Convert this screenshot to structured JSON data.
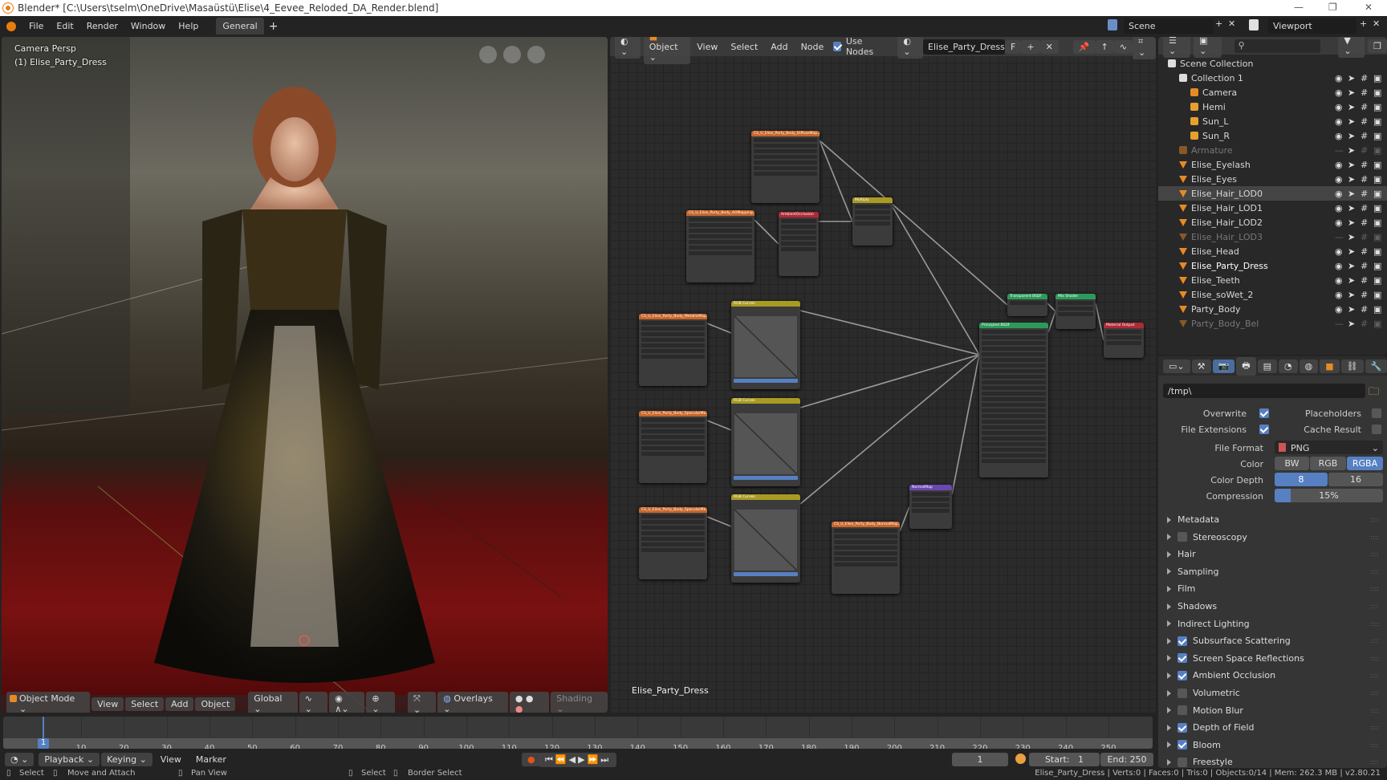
{
  "window": {
    "title": "Blender* [C:\\Users\\tselm\\OneDrive\\Masaüstü\\Elise\\4_Eevee_Reloded_DA_Render.blend]"
  },
  "topbar": {
    "menus": [
      "File",
      "Edit",
      "Render",
      "Window",
      "Help"
    ],
    "workspace_tab": "General",
    "add_tab": "+",
    "scene": "Scene",
    "view_layer": "Viewport"
  },
  "viewport": {
    "camera_label": "Camera Persp",
    "object_label": "(1) Elise_Party_Dress",
    "header": {
      "mode": "Object Mode",
      "menus": [
        "View",
        "Select",
        "Add",
        "Object"
      ],
      "orientation": "Global",
      "overlays": "Overlays",
      "shading": "Shading"
    }
  },
  "node_editor": {
    "header": {
      "type": "Object",
      "menus": [
        "View",
        "Select",
        "Add",
        "Node"
      ],
      "use_nodes": "Use Nodes",
      "use_nodes_checked": true,
      "material": "Elise_Party_Dress",
      "fake_user": "F"
    },
    "footer_label": "Elise_Party_Dress",
    "nodes": [
      {
        "title": "CS_U_Elise_Party_Body_DiffuseMap.p...",
        "color": "#c8662a",
        "rows": 7
      },
      {
        "title": "CS_U_Elise_Party_Body_AOMapping...",
        "color": "#c8662a",
        "rows": 7
      },
      {
        "title": "AmbientOcclusion",
        "color": "#b02a35",
        "rows": 6
      },
      {
        "title": "Multiply",
        "color": "#a99a22",
        "rows": 4
      },
      {
        "title": "CS_U_Elise_Party_Body_MetallicMap...",
        "color": "#c8662a",
        "rows": 7
      },
      {
        "title": "RGB Curves",
        "color": "#a99a22",
        "rows": 0
      },
      {
        "title": "CS_U_Elise_Party_Body_SpecularMa...",
        "color": "#c8662a",
        "rows": 7
      },
      {
        "title": "RGB Curves",
        "color": "#a99a22",
        "rows": 0
      },
      {
        "title": "CS_U_Elise_Party_Body_SpecularMa...",
        "color": "#c8662a",
        "rows": 7
      },
      {
        "title": "RGB Curves",
        "color": "#a99a22",
        "rows": 0
      },
      {
        "title": "CS_U_Elise_Party_Body_NormalMap...",
        "color": "#c8662a",
        "rows": 7
      },
      {
        "title": "NormalMap",
        "color": "#6b47b0",
        "rows": 4
      },
      {
        "title": "Principled BSDF",
        "color": "#2c9a5a",
        "rows": 24
      },
      {
        "title": "Transparent BSDF",
        "color": "#2c9a5a",
        "rows": 1
      },
      {
        "title": "Mix Shader",
        "color": "#2c9a5a",
        "rows": 3
      },
      {
        "title": "Material Output",
        "color": "#b02a35",
        "rows": 3
      }
    ]
  },
  "outliner": {
    "items": [
      {
        "name": "Scene Collection",
        "level": 0,
        "type": "scene"
      },
      {
        "name": "Collection 1",
        "level": 1,
        "type": "collection"
      },
      {
        "name": "Camera",
        "level": 2,
        "type": "camera"
      },
      {
        "name": "Hemi",
        "level": 2,
        "type": "light"
      },
      {
        "name": "Sun_L",
        "level": 2,
        "type": "light"
      },
      {
        "name": "Sun_R",
        "level": 2,
        "type": "light"
      },
      {
        "name": "Armature",
        "level": 1,
        "type": "armature",
        "hidden": true
      },
      {
        "name": "Elise_Eyelash",
        "level": 1,
        "type": "mesh"
      },
      {
        "name": "Elise_Eyes",
        "level": 1,
        "type": "mesh"
      },
      {
        "name": "Elise_Hair_LOD0",
        "level": 1,
        "type": "mesh",
        "selected": true
      },
      {
        "name": "Elise_Hair_LOD1",
        "level": 1,
        "type": "mesh"
      },
      {
        "name": "Elise_Hair_LOD2",
        "level": 1,
        "type": "mesh"
      },
      {
        "name": "Elise_Hair_LOD3",
        "level": 1,
        "type": "mesh",
        "hidden": true
      },
      {
        "name": "Elise_Head",
        "level": 1,
        "type": "mesh"
      },
      {
        "name": "Elise_Party_Dress",
        "level": 1,
        "type": "mesh",
        "active": true
      },
      {
        "name": "Elise_Teeth",
        "level": 1,
        "type": "mesh"
      },
      {
        "name": "Elise_soWet_2",
        "level": 1,
        "type": "mesh"
      },
      {
        "name": "Party_Body",
        "level": 1,
        "type": "mesh"
      },
      {
        "name": "Party_Body_Bel",
        "level": 1,
        "type": "mesh",
        "hidden": true
      }
    ]
  },
  "properties": {
    "output_path": "/tmp\\",
    "overwrite": {
      "label": "Overwrite",
      "checked": true
    },
    "placeholders": {
      "label": "Placeholders",
      "checked": false
    },
    "file_extensions": {
      "label": "File Extensions",
      "checked": true
    },
    "cache_result": {
      "label": "Cache Result",
      "checked": false
    },
    "file_format": {
      "label": "File Format",
      "value": "PNG"
    },
    "color": {
      "label": "Color",
      "options": [
        "BW",
        "RGB",
        "RGBA"
      ],
      "selected": "RGBA"
    },
    "color_depth": {
      "label": "Color Depth",
      "options": [
        "8",
        "16"
      ],
      "selected": "8"
    },
    "compression": {
      "label": "Compression",
      "value": "15%",
      "percent": 15
    },
    "panels": [
      {
        "label": "Metadata"
      },
      {
        "label": "Stereoscopy",
        "checked": false
      },
      {
        "label": "Hair"
      },
      {
        "label": "Sampling"
      },
      {
        "label": "Film"
      },
      {
        "label": "Shadows"
      },
      {
        "label": "Indirect Lighting"
      },
      {
        "label": "Subsurface Scattering",
        "checked": true
      },
      {
        "label": "Screen Space Reflections",
        "checked": true
      },
      {
        "label": "Ambient Occlusion",
        "checked": true
      },
      {
        "label": "Volumetric",
        "checked": false
      },
      {
        "label": "Motion Blur",
        "checked": false
      },
      {
        "label": "Depth of Field",
        "checked": true
      },
      {
        "label": "Bloom",
        "checked": true
      },
      {
        "label": "Freestyle",
        "checked": false
      }
    ],
    "accent": "#5680c2"
  },
  "timeline": {
    "current_frame": "1",
    "ticks": [
      "1",
      "10",
      "20",
      "30",
      "40",
      "50",
      "60",
      "70",
      "80",
      "90",
      "100",
      "110",
      "120",
      "130",
      "140",
      "150",
      "160",
      "170",
      "180",
      "190",
      "200",
      "210",
      "220",
      "230",
      "240",
      "250"
    ],
    "menus": [
      "Playback",
      "Keying",
      "View",
      "Marker"
    ],
    "frame_field": "1",
    "start_label": "Start:",
    "start": "1",
    "end_label": "End:",
    "end": "250"
  },
  "statusbar": {
    "left": [
      "Select",
      "Move and Attach",
      "Pan View",
      "Select",
      "Border Select"
    ],
    "stats": "Elise_Party_Dress | Verts:0 | Faces:0 | Tris:0 | Objects:0/14 | Mem: 262.3 MB | v2.80.21"
  }
}
